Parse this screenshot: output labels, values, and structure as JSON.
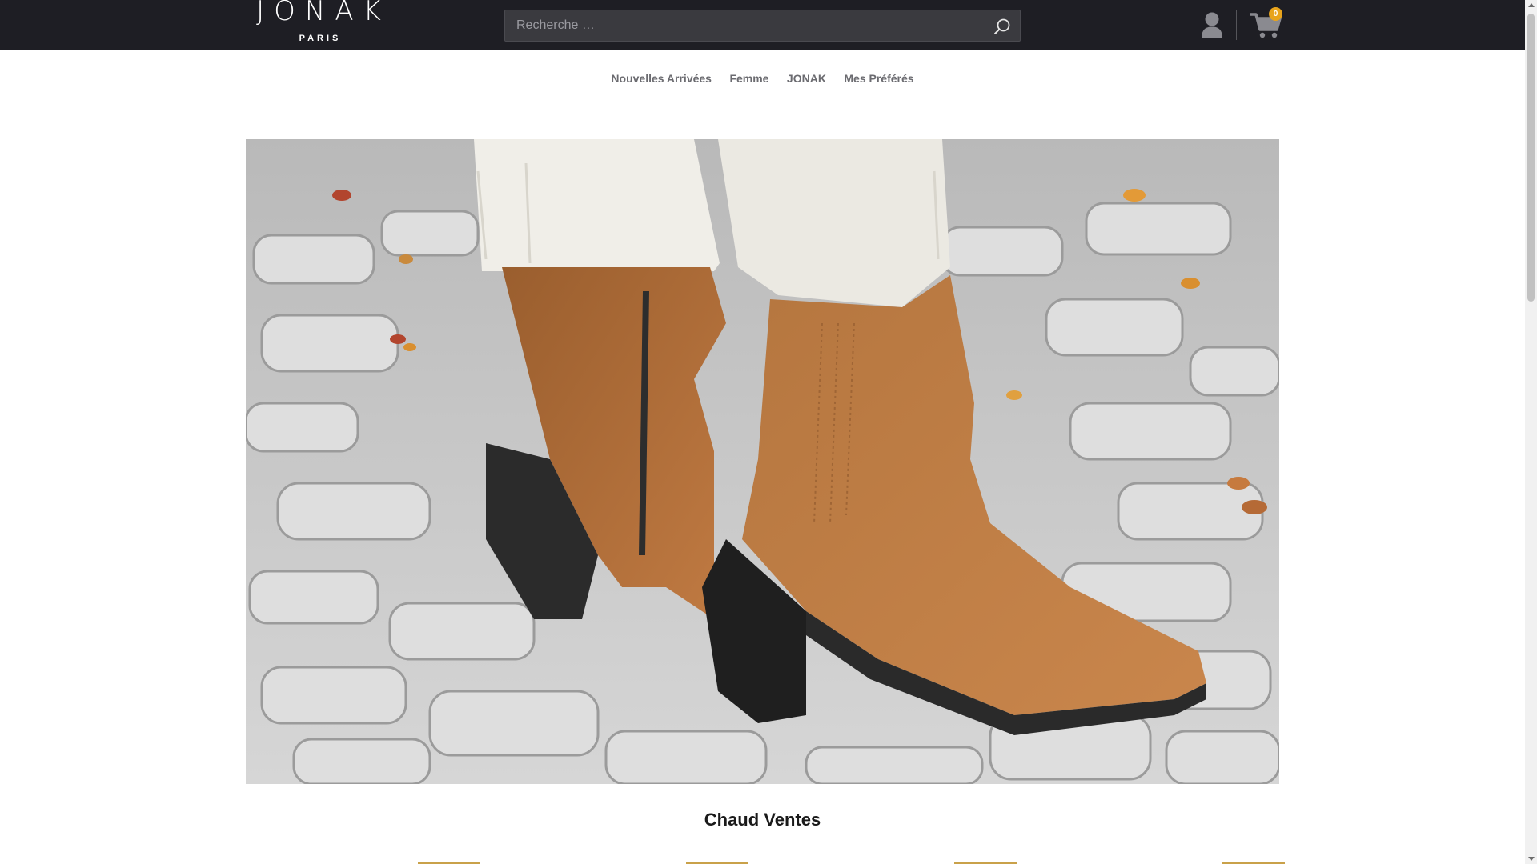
{
  "header": {
    "logo_text": "JONAK",
    "logo_subtext": "PARIS",
    "search_placeholder": "Recherche …",
    "cart_count": "0",
    "icons": {
      "search": "search-icon",
      "account": "user-icon",
      "cart": "shopping-cart-icon"
    }
  },
  "nav": {
    "items": [
      {
        "label": "Nouvelles Arrivées"
      },
      {
        "label": "Femme"
      },
      {
        "label": "JONAK"
      },
      {
        "label": "Mes Préférés"
      }
    ]
  },
  "hero": {
    "image_alt": "Bottines en daim camel sur pavés"
  },
  "sections": {
    "hot_sales_title": "Chaud Ventes"
  },
  "colors": {
    "topbar": "#1e1e24",
    "nav_text": "#6b6b70",
    "badge": "#e8a41c",
    "accent_gold": "#c9a14a"
  }
}
